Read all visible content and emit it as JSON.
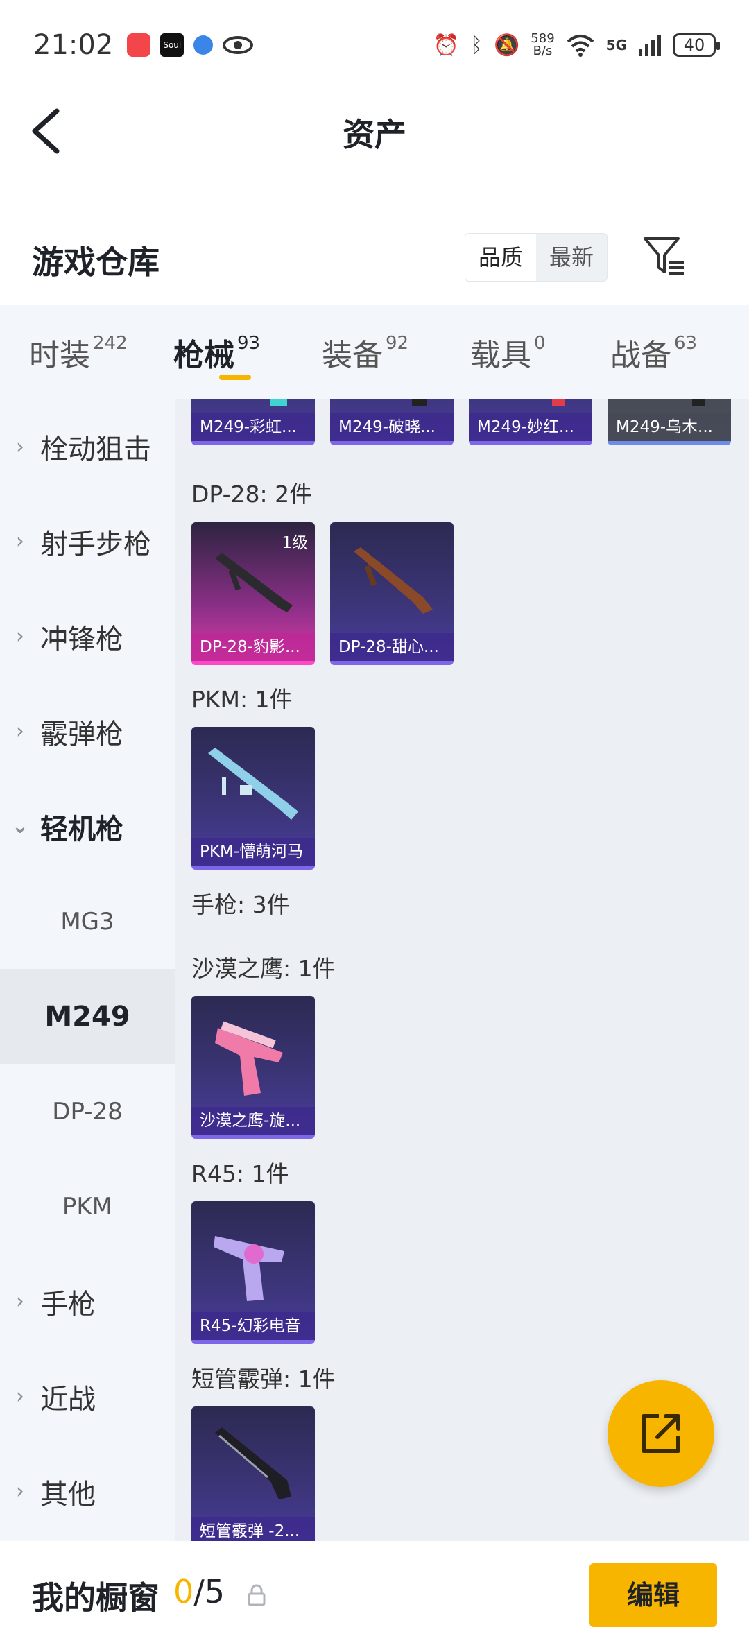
{
  "status_bar": {
    "time": "21:02",
    "net_speed_value": "589",
    "net_speed_unit": "B/s",
    "network": "5G",
    "battery": "40",
    "notif_soul": "Soul"
  },
  "header": {
    "title": "资产"
  },
  "warehouse": {
    "title": "游戏仓库",
    "sort_options": [
      "品质",
      "最新"
    ]
  },
  "tabs": [
    {
      "label": "时装",
      "count": "242"
    },
    {
      "label": "枪械",
      "count": "93"
    },
    {
      "label": "装备",
      "count": "92"
    },
    {
      "label": "载具",
      "count": "0"
    },
    {
      "label": "战备",
      "count": "63"
    }
  ],
  "sidebar": {
    "items": [
      "栓动狙击",
      "射手步枪",
      "冲锋枪",
      "霰弹枪",
      "轻机枪"
    ],
    "sub_items": [
      "MG3",
      "M249",
      "DP-28",
      "PKM"
    ],
    "items_after": [
      "手枪",
      "近战",
      "其他"
    ]
  },
  "content": {
    "top_cards": [
      "M249-彩虹...",
      "M249-破晓...",
      "M249-妙红...",
      "M249-乌木..."
    ],
    "groups": [
      {
        "title": "DP-28: 2件",
        "cards": [
          {
            "caption": "DP-28-豹影...",
            "level": "1级"
          },
          {
            "caption": "DP-28-甜心..."
          }
        ]
      },
      {
        "title": "PKM: 1件",
        "cards": [
          {
            "caption": "PKM-懵萌河马"
          }
        ]
      },
      {
        "title": "手枪: 3件"
      },
      {
        "title": "沙漠之鹰: 1件",
        "cards": [
          {
            "caption": "沙漠之鹰-旋..."
          }
        ]
      },
      {
        "title": "R45: 1件",
        "cards": [
          {
            "caption": "R45-幻彩电音"
          }
        ]
      },
      {
        "title": "短管霰弹: 1件",
        "cards": [
          {
            "caption": "短管霰弹 -2..."
          }
        ]
      }
    ]
  },
  "bottom_bar": {
    "label": "我的橱窗",
    "count_current": "0",
    "count_sep_total": "/5",
    "edit_label": "编辑"
  }
}
